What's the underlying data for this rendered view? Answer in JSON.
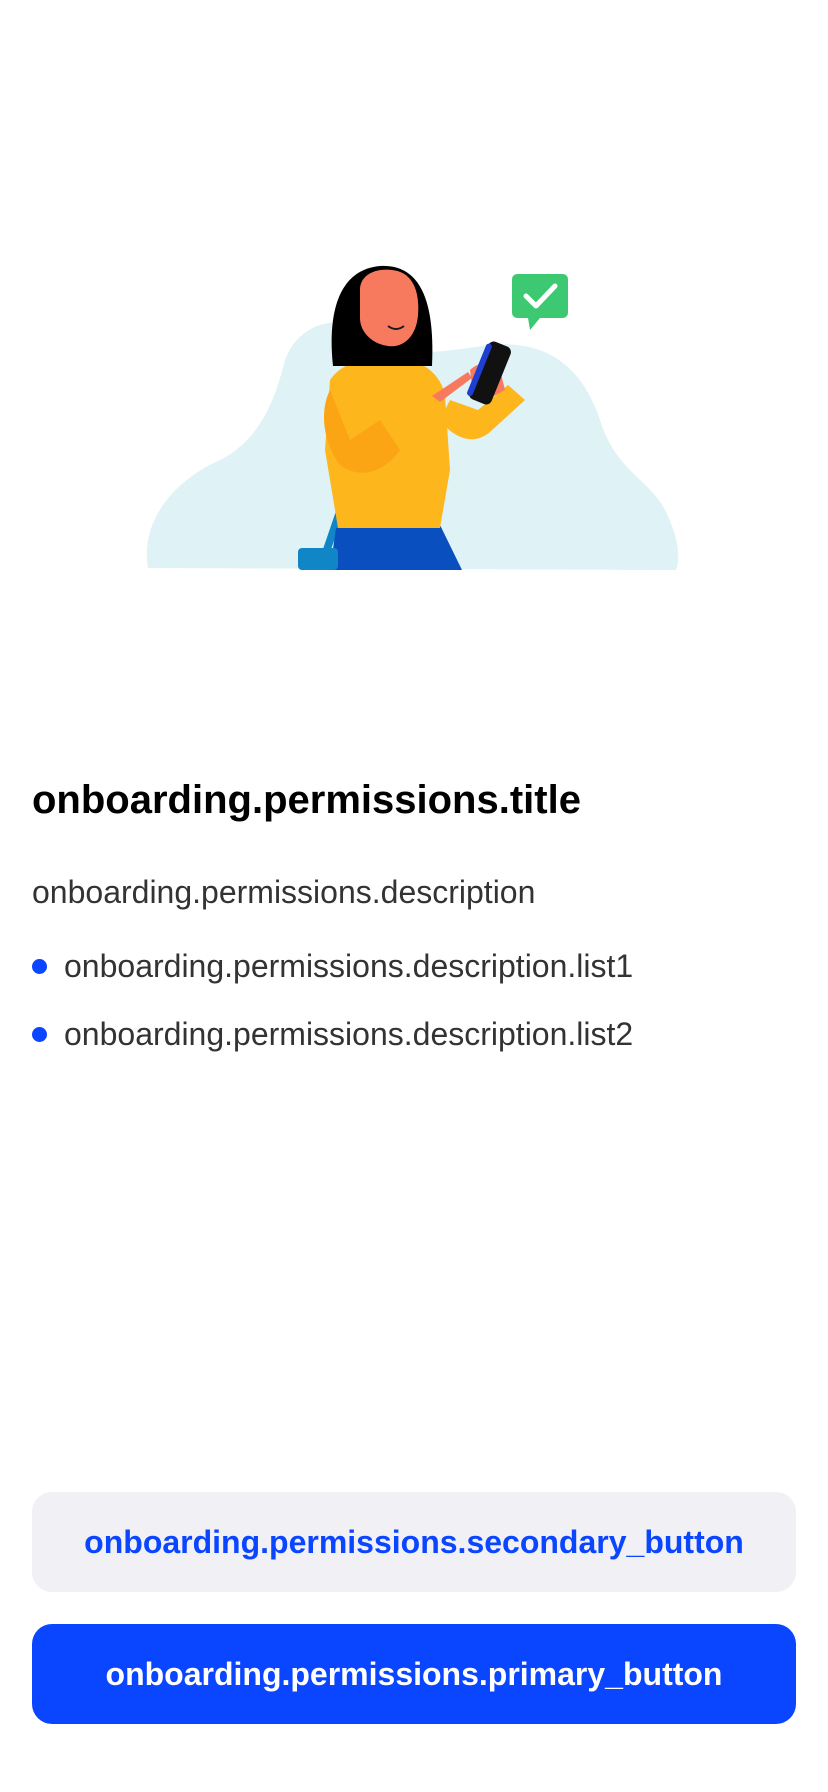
{
  "illustration": {
    "icon": "woman-with-phone-illustration",
    "colors": {
      "blob": "#dff2f5",
      "sweater": "#fdb71d",
      "skin": "#f87a5e",
      "hair": "#000000",
      "skirt": "#0a4fc0",
      "bag": "#1186c7",
      "check_badge": "#3dc972"
    }
  },
  "content": {
    "title": "onboarding.permissions.title",
    "description": "onboarding.permissions.description",
    "list": [
      "onboarding.permissions.description.list1",
      "onboarding.permissions.description.list2"
    ],
    "bullet_color": "#0a46ff"
  },
  "buttons": {
    "secondary_label": "onboarding.permissions.secondary_button",
    "primary_label": "onboarding.permissions.primary_button",
    "accent_color": "#0a46ff"
  }
}
